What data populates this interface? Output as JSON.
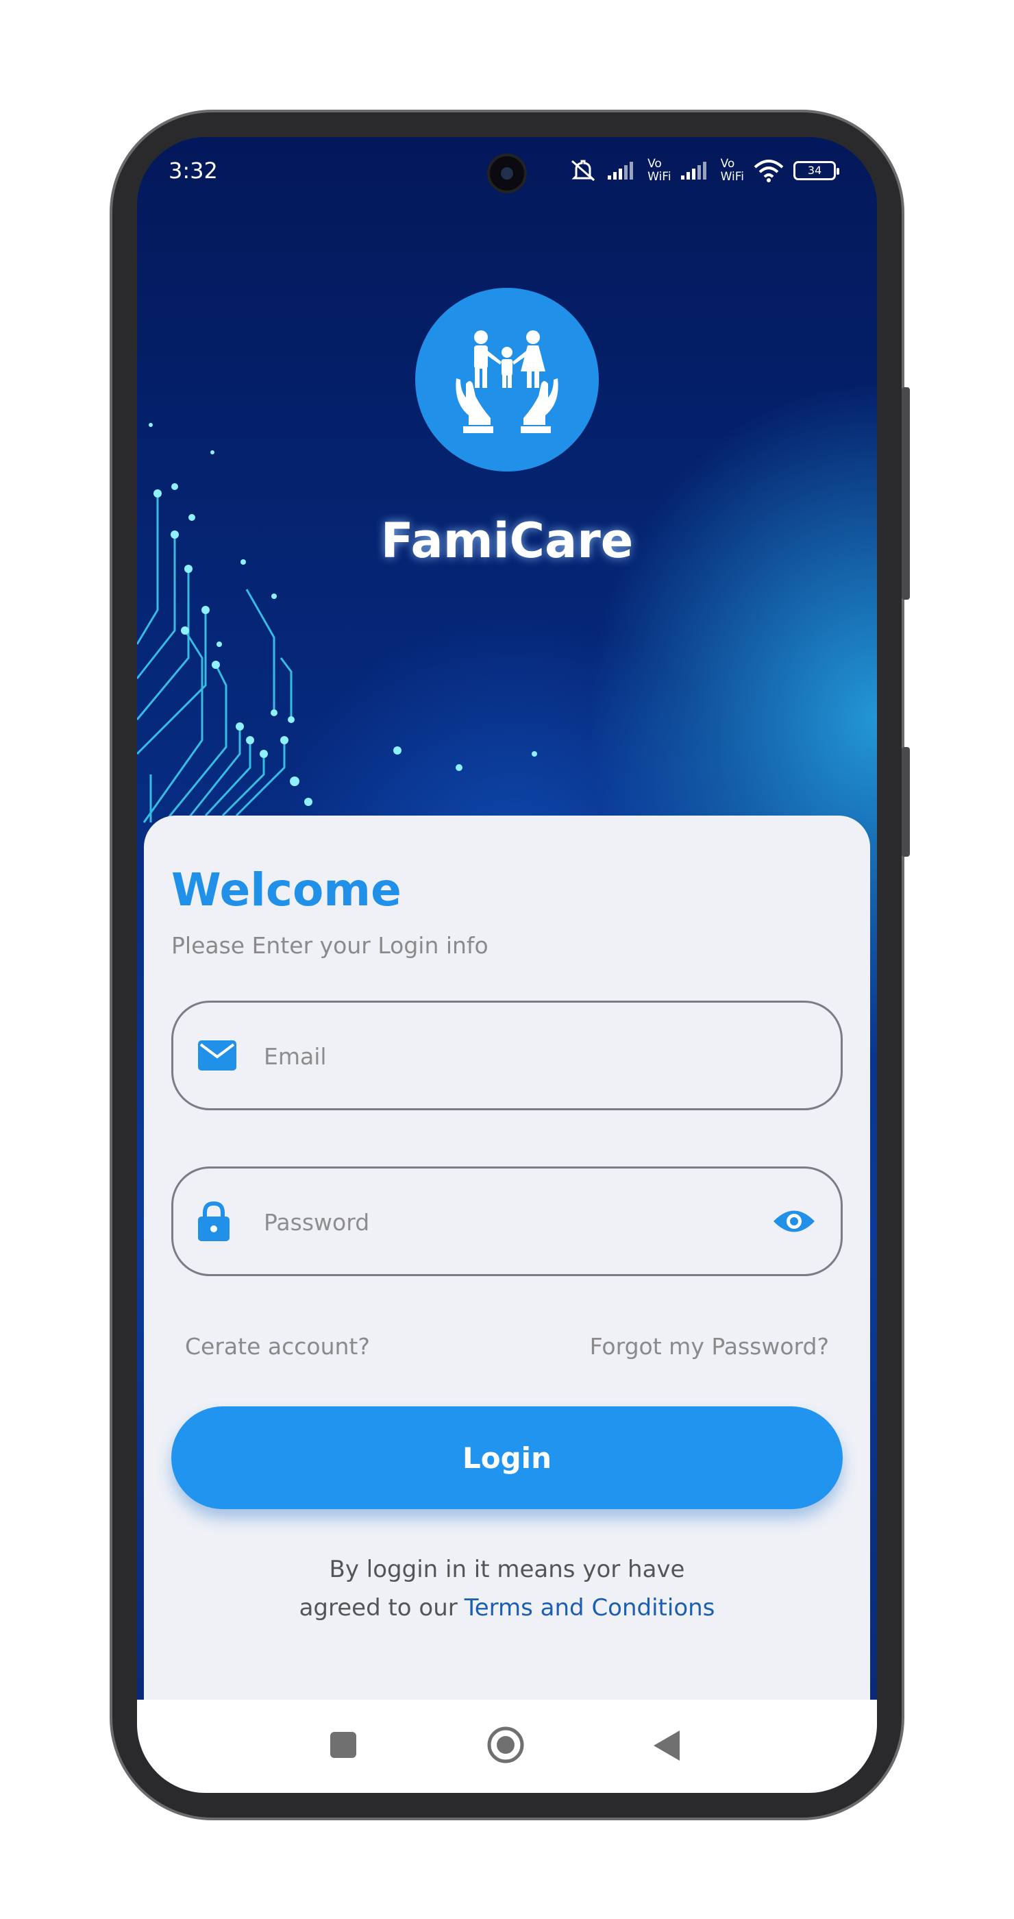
{
  "status_bar": {
    "time": "3:32",
    "vo_label": "Vo",
    "wifi_label": "WiFi",
    "battery": "34"
  },
  "app": {
    "name": "FamiCare"
  },
  "login": {
    "title": "Welcome",
    "subtitle": "Please Enter your Login info",
    "email_placeholder": "Email",
    "password_placeholder": "Password",
    "create_account": "Cerate account?",
    "forgot_password": "Forgot my Password?",
    "login_button": "Login",
    "terms_line1": "By loggin in it means yor have",
    "terms_line2": "agreed to our",
    "terms_link": "Terms and Conditions"
  },
  "colors": {
    "accent": "#2190e8",
    "link": "#1a5fb4",
    "card": "#eff1f7"
  },
  "icons": [
    "mute-icon",
    "signal-icon",
    "wifi-icon",
    "battery-icon",
    "family-care-logo",
    "email-icon",
    "lock-icon",
    "eye-icon",
    "recent-apps-icon",
    "home-icon",
    "back-icon"
  ]
}
